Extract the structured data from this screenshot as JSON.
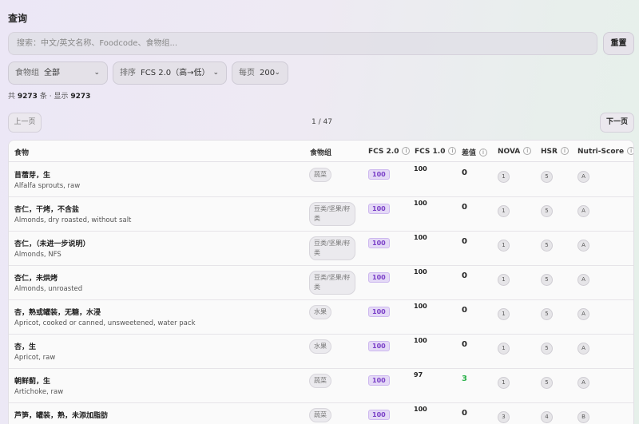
{
  "page": {
    "title": "查询"
  },
  "search": {
    "placeholder": "搜索：中文/英文名称、Foodcode、食物组..."
  },
  "reset_label": "重置",
  "filters": {
    "group": {
      "label": "食物组",
      "value": "全部"
    },
    "sort": {
      "label": "排序",
      "value": "FCS 2.0（高→低）"
    },
    "per_page": {
      "label": "每页",
      "value": "200"
    }
  },
  "count": {
    "prefix": "共",
    "total": "9273",
    "unit": "条",
    "shown_prefix": "· 显示",
    "shown": "9273"
  },
  "pagination": {
    "prev": "上一页",
    "info": "1 / 47",
    "next": "下一页"
  },
  "table": {
    "columns": [
      "食物",
      "食物组",
      "FCS 2.0",
      "FCS 1.0",
      "差值",
      "NOVA",
      "HSR",
      "Nutri-Score"
    ],
    "rows": [
      {
        "zh": "苜蓿芽，生",
        "en": "Alfalfa sprouts, raw",
        "group": "蔬菜",
        "fcs2": "100",
        "fcs1": "100",
        "diff": "0",
        "nova": "1",
        "hsr": "5",
        "nutri": "A"
      },
      {
        "zh": "杏仁，干烤，不含盐",
        "en": "Almonds, dry roasted, without salt",
        "group": "豆类/坚果/籽类",
        "fcs2": "100",
        "fcs1": "100",
        "diff": "0",
        "nova": "1",
        "hsr": "5",
        "nutri": "A"
      },
      {
        "zh": "杏仁，（未进一步说明）",
        "en": "Almonds, NFS",
        "group": "豆类/坚果/籽类",
        "fcs2": "100",
        "fcs1": "100",
        "diff": "0",
        "nova": "1",
        "hsr": "5",
        "nutri": "A"
      },
      {
        "zh": "杏仁，未烘烤",
        "en": "Almonds, unroasted",
        "group": "豆类/坚果/籽类",
        "fcs2": "100",
        "fcs1": "100",
        "diff": "0",
        "nova": "1",
        "hsr": "5",
        "nutri": "A"
      },
      {
        "zh": "杏，熟或罐装，无糖，水浸",
        "en": "Apricot, cooked or canned, unsweetened, water pack",
        "group": "水果",
        "fcs2": "100",
        "fcs1": "100",
        "diff": "0",
        "nova": "1",
        "hsr": "5",
        "nutri": "A"
      },
      {
        "zh": "杏，生",
        "en": "Apricot, raw",
        "group": "水果",
        "fcs2": "100",
        "fcs1": "100",
        "diff": "0",
        "nova": "1",
        "hsr": "5",
        "nutri": "A"
      },
      {
        "zh": "朝鲜蓟，生",
        "en": "Artichoke, raw",
        "group": "蔬菜",
        "fcs2": "100",
        "fcs1": "97",
        "diff": "3",
        "nova": "1",
        "hsr": "5",
        "nutri": "A"
      },
      {
        "zh": "芦笋，罐装，熟，未添加脂肪",
        "en": "",
        "group": "蔬菜",
        "fcs2": "100",
        "fcs1": "100",
        "diff": "0",
        "nova": "3",
        "hsr": "4",
        "nutri": "B"
      }
    ]
  }
}
